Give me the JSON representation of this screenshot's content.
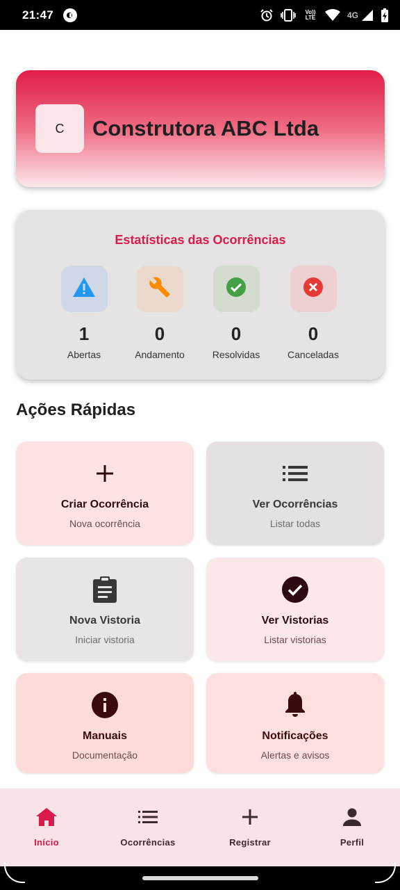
{
  "status_bar": {
    "time": "21:47",
    "volte": "Vo)) LTE",
    "network": "4G"
  },
  "company": {
    "initial": "C",
    "name": "Construtora ABC Ltda"
  },
  "stats": {
    "title": "Estatísticas das Ocorrências",
    "items": [
      {
        "value": "1",
        "label": "Abertas",
        "icon": "warning-icon",
        "color": "#2196f3",
        "bg": "#cfd8e6"
      },
      {
        "value": "0",
        "label": "Andamento",
        "icon": "wrench-icon",
        "color": "#fb8c00",
        "bg": "#ead9cc"
      },
      {
        "value": "0",
        "label": "Resolvidas",
        "icon": "check-circle-icon",
        "color": "#43a047",
        "bg": "#d3dccf"
      },
      {
        "value": "0",
        "label": "Canceladas",
        "icon": "cancel-icon",
        "color": "#e53935",
        "bg": "#ecd0d2"
      }
    ]
  },
  "quick_actions": {
    "title": "Ações Rápidas",
    "items": [
      {
        "title": "Criar Ocorrência",
        "subtitle": "Nova ocorrência",
        "icon": "plus-icon",
        "bg": "#fde3e4"
      },
      {
        "title": "Ver Ocorrências",
        "subtitle": "Listar todas",
        "icon": "list-icon",
        "bg": "#e5e1e1"
      },
      {
        "title": "Nova Vistoria",
        "subtitle": "Iniciar vistoria",
        "icon": "clipboard-icon",
        "bg": "#e8e5e4"
      },
      {
        "title": "Ver Vistorias",
        "subtitle": "Listar vistorias",
        "icon": "check-circle-icon",
        "bg": "#fde8e9"
      },
      {
        "title": "Manuais",
        "subtitle": "Documentação",
        "icon": "info-icon",
        "bg": "#fddcd9"
      },
      {
        "title": "Notificações",
        "subtitle": "Alertas e avisos",
        "icon": "bell-icon",
        "bg": "#fde0dd"
      }
    ]
  },
  "bottom_nav": {
    "items": [
      {
        "label": "Início",
        "icon": "home-icon",
        "active": true
      },
      {
        "label": "Ocorrências",
        "icon": "list-icon",
        "active": false
      },
      {
        "label": "Registrar",
        "icon": "plus-icon",
        "active": false
      },
      {
        "label": "Perfil",
        "icon": "person-icon",
        "active": false
      }
    ],
    "active_color": "#d81b4a",
    "inactive_color": "#3a2a2c"
  }
}
